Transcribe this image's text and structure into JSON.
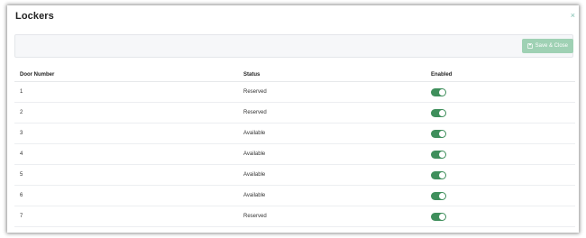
{
  "modal": {
    "title": "Lockers",
    "close_glyph": "×"
  },
  "toolbar": {
    "save_label": "Save & Close",
    "save_icon": "floppy-disk-icon"
  },
  "table": {
    "headers": {
      "door": "Door Number",
      "status": "Status",
      "enabled": "Enabled"
    },
    "rows": [
      {
        "door": "1",
        "status": "Reserved",
        "enabled": true
      },
      {
        "door": "2",
        "status": "Reserved",
        "enabled": true
      },
      {
        "door": "3",
        "status": "Available",
        "enabled": true
      },
      {
        "door": "4",
        "status": "Available",
        "enabled": true
      },
      {
        "door": "5",
        "status": "Available",
        "enabled": true
      },
      {
        "door": "6",
        "status": "Available",
        "enabled": true
      },
      {
        "door": "7",
        "status": "Reserved",
        "enabled": true
      }
    ]
  },
  "colors": {
    "toggle_on": "#3f8f5c",
    "save_button": "#9fd1b4",
    "close_icon": "#7fbfb0"
  }
}
